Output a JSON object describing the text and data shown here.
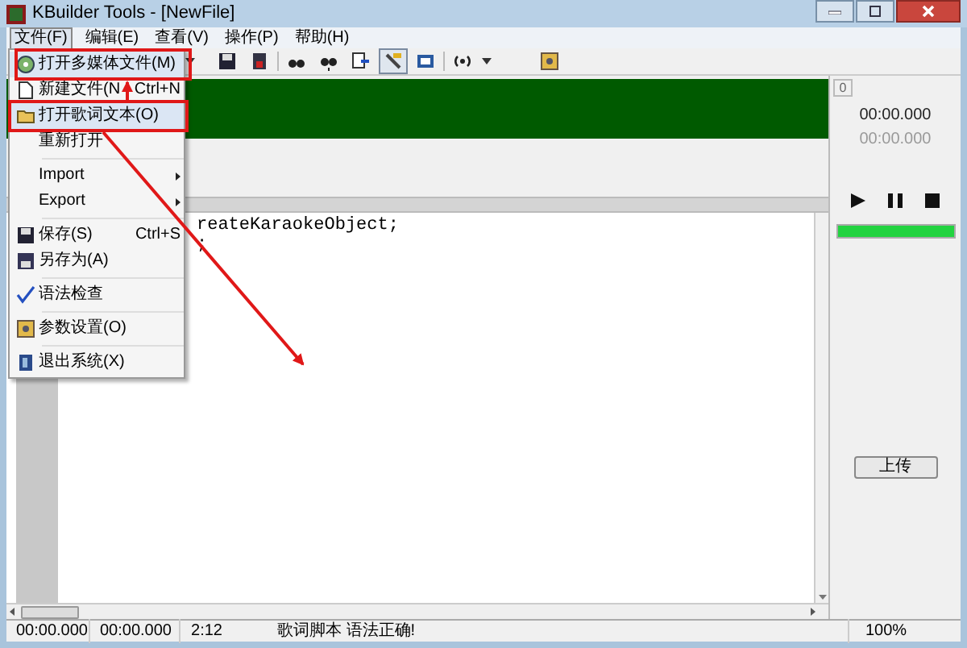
{
  "window": {
    "title": "KBuilder Tools - [NewFile]"
  },
  "menubar": [
    {
      "label": "文件(F)",
      "selected": true
    },
    {
      "label": "编辑(E)",
      "selected": false
    },
    {
      "label": "查看(V)",
      "selected": false
    },
    {
      "label": "操作(P)",
      "selected": false
    },
    {
      "label": "帮助(H)",
      "selected": false
    }
  ],
  "file_menu": [
    {
      "kind": "item",
      "label": "打开多媒体文件(M)",
      "highlighted": true
    },
    {
      "kind": "item",
      "label": "新建文件(N",
      "shortcut": "Ctrl+N",
      "highlighted": false
    },
    {
      "kind": "item",
      "label": "打开歌词文本(O)",
      "highlighted": true
    },
    {
      "kind": "item",
      "label": "重新打开",
      "highlighted": false
    },
    {
      "kind": "separator"
    },
    {
      "kind": "submenu",
      "label": "Import",
      "highlighted": false
    },
    {
      "kind": "submenu",
      "label": "Export",
      "highlighted": false
    },
    {
      "kind": "separator"
    },
    {
      "kind": "item",
      "label": "保存(S)",
      "shortcut": "Ctrl+S",
      "highlighted": false
    },
    {
      "kind": "item",
      "label": "另存为(A)",
      "highlighted": false
    },
    {
      "kind": "separator"
    },
    {
      "kind": "item",
      "label": "语法检查",
      "highlighted": false
    },
    {
      "kind": "separator"
    },
    {
      "kind": "item",
      "label": "参数设置(O)",
      "highlighted": false
    },
    {
      "kind": "separator"
    },
    {
      "kind": "item",
      "label": "退出系统(X)",
      "highlighted": false
    }
  ],
  "editor": {
    "lines": [
      "reateKaraokeObject;",
      ";"
    ]
  },
  "player": {
    "counter": "0",
    "time_current": "00:00.000",
    "time_total": "00:00.000",
    "progress": {
      "level": 1
    },
    "upload_button": "上传"
  },
  "status_bar": [
    "00:00.000",
    "00:00.000",
    "2:12",
    "歌词脚本 语法正确!",
    "100%"
  ]
}
